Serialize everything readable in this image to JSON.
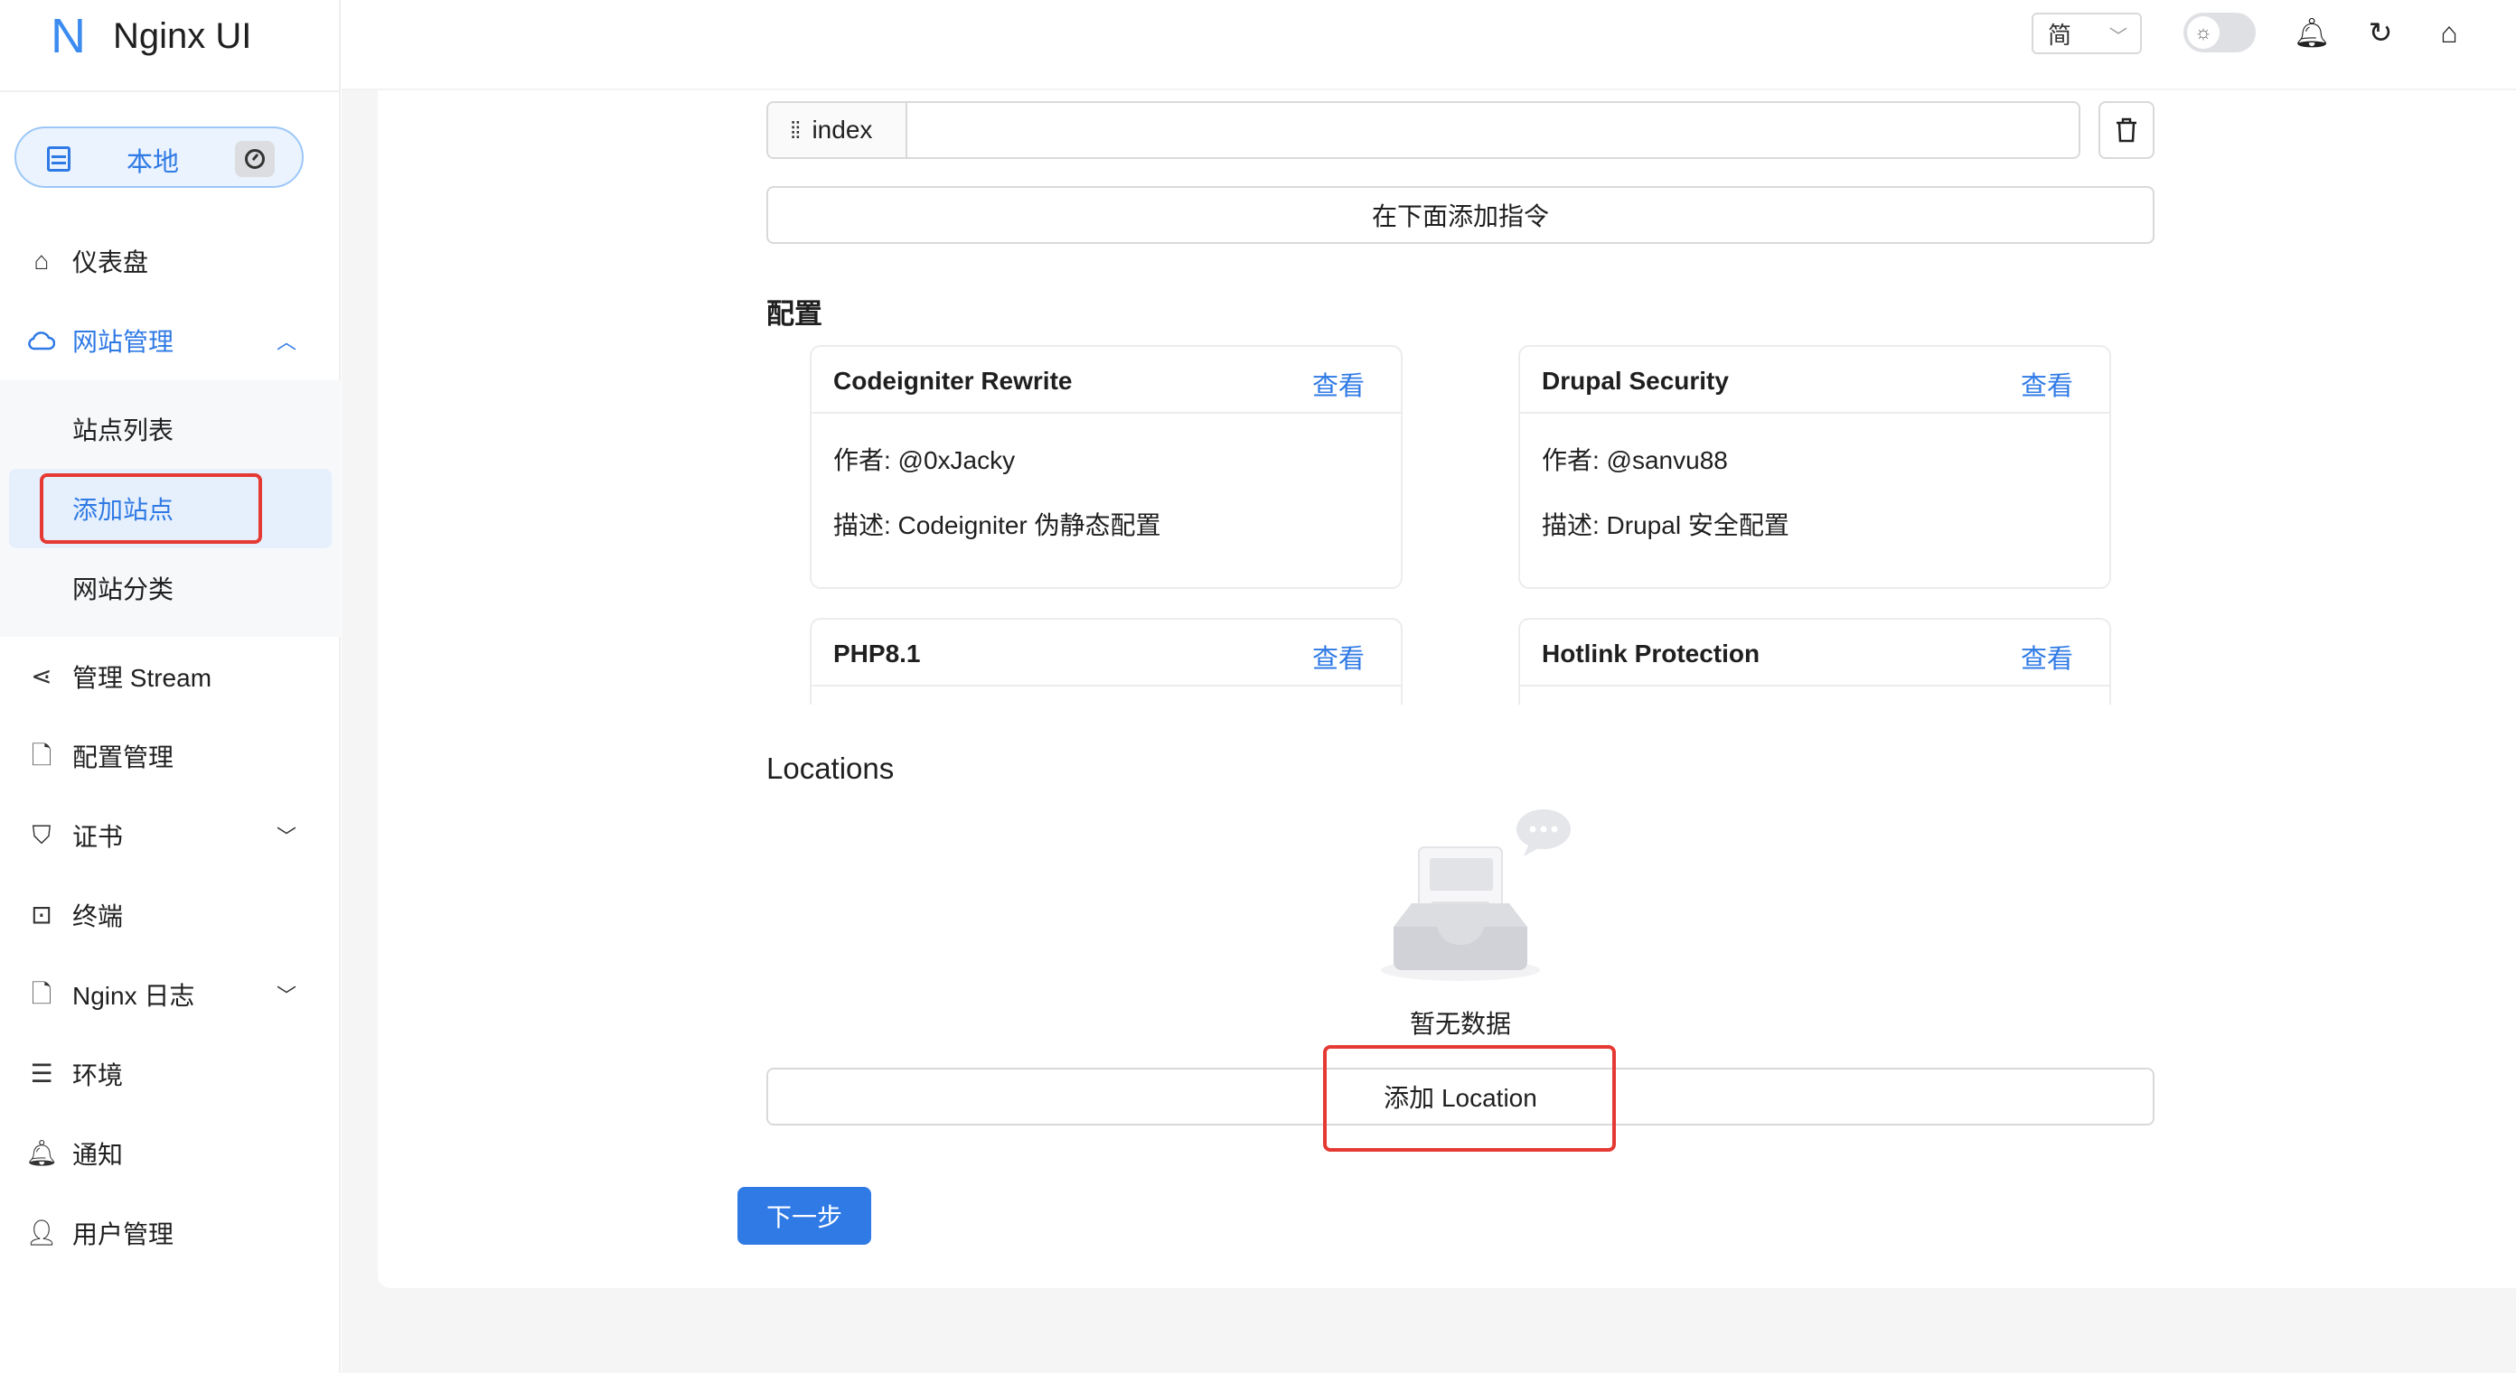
{
  "app": {
    "title": "Nginx UI",
    "logo_letter": "N"
  },
  "env_switch": {
    "label": "本地",
    "left_icon": "server-icon",
    "right_icon": "dashboard-gauge-icon"
  },
  "sidebar": {
    "items": [
      {
        "label": "仪表盘",
        "icon": "home-icon"
      },
      {
        "label": "网站管理",
        "icon": "cloud-icon",
        "expanded": true
      },
      {
        "label": "管理 Stream",
        "icon": "share-icon"
      },
      {
        "label": "配置管理",
        "icon": "file-icon"
      },
      {
        "label": "证书",
        "icon": "shield-icon"
      },
      {
        "label": "终端",
        "icon": "terminal-icon"
      },
      {
        "label": "Nginx 日志",
        "icon": "file-icon"
      },
      {
        "label": "环境",
        "icon": "server-icon"
      },
      {
        "label": "通知",
        "icon": "bell-icon"
      },
      {
        "label": "用户管理",
        "icon": "user-icon"
      }
    ],
    "sites_submenu": [
      {
        "label": "站点列表"
      },
      {
        "label": "添加站点",
        "selected": true
      },
      {
        "label": "网站分类"
      }
    ]
  },
  "header": {
    "language": "简",
    "icons": [
      "sun-icon",
      "bell-icon",
      "reload-icon",
      "home-icon"
    ]
  },
  "editor": {
    "directive_name": "index",
    "directive_value": "",
    "add_directive_label": "在下面添加指令",
    "config_title": "配置",
    "templates": [
      {
        "name": "Codeigniter Rewrite",
        "view": "查看",
        "author": "作者: @0xJacky",
        "desc": "描述: Codeigniter 伪静态配置"
      },
      {
        "name": "Drupal Security",
        "view": "查看",
        "author": "作者: @sanvu88",
        "desc": "描述: Drupal 安全配置"
      },
      {
        "name": "PHP8.1",
        "view": "查看"
      },
      {
        "name": "Hotlink Protection",
        "view": "查看"
      }
    ],
    "locations_title": "Locations",
    "empty_text": "暂无数据",
    "add_location_label": "添加 Location",
    "next_label": "下一步"
  },
  "colors": {
    "primary": "#2f7ae5",
    "highlight_box": "#e53a33"
  }
}
